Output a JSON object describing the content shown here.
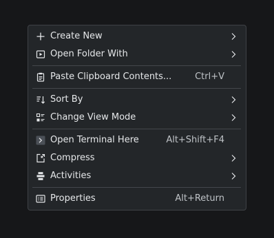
{
  "menu": {
    "items": [
      {
        "label": "Create New",
        "icon": "plus-icon",
        "submenu": true
      },
      {
        "label": "Open Folder With",
        "icon": "play-window-icon",
        "submenu": true
      },
      {
        "label": "Paste Clipboard Contents...",
        "icon": "clipboard-icon",
        "shortcut": "Ctrl+V"
      },
      {
        "label": "Sort By",
        "icon": "sort-icon",
        "submenu": true
      },
      {
        "label": "Change View Mode",
        "icon": "view-mode-icon",
        "submenu": true
      },
      {
        "label": "Open Terminal Here",
        "icon": "terminal-icon",
        "shortcut": "Alt+Shift+F4"
      },
      {
        "label": "Compress",
        "icon": "compress-icon",
        "submenu": true
      },
      {
        "label": "Activities",
        "icon": "activities-icon",
        "submenu": true
      },
      {
        "label": "Properties",
        "icon": "properties-icon",
        "shortcut": "Alt+Return"
      }
    ]
  },
  "colors": {
    "background": "#161719",
    "menu_background": "#232629",
    "menu_border": "#3f4246",
    "text": "#e6e8ea",
    "shortcut_text": "#bfc3c7",
    "separator": "#44474c"
  }
}
